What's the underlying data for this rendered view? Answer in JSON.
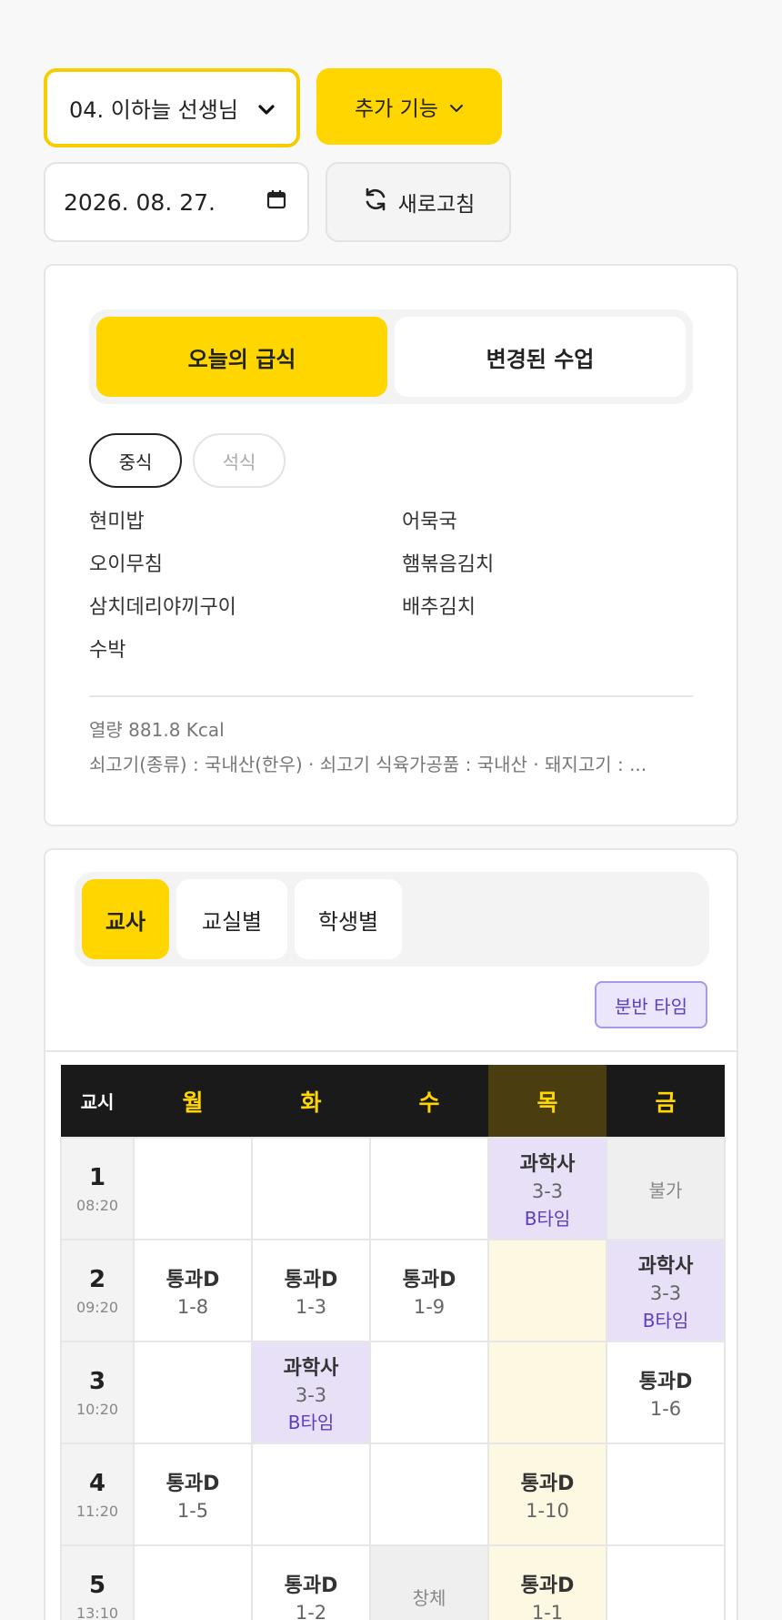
{
  "controls": {
    "teacher_select": "04. 이하늘 선생님",
    "extra_button": "추가 기능",
    "date_value": "2026. 08. 27.",
    "refresh_button": "새로고침"
  },
  "meal": {
    "tabs": [
      "오늘의 급식",
      "변경된 수업"
    ],
    "chips": [
      "중식",
      "석식"
    ],
    "items": [
      "현미밥",
      "어묵국",
      "오이무침",
      "햄볶음김치",
      "삼치데리야끼구이",
      "배추김치",
      "수박"
    ],
    "calories": "열량 881.8 Kcal",
    "origin": "쇠고기(종류) : 국내산(한우) · 쇠고기 식육가공품 : 국내산 · 돼지고기 : ..."
  },
  "timetable": {
    "tabs": [
      "교사",
      "교실별",
      "학생별"
    ],
    "split_badge": "분반 타임",
    "corner": "교시",
    "days": [
      "월",
      "화",
      "수",
      "목",
      "금"
    ],
    "periods": [
      {
        "num": "1",
        "time": "08:20"
      },
      {
        "num": "2",
        "time": "09:20"
      },
      {
        "num": "3",
        "time": "10:20"
      },
      {
        "num": "4",
        "time": "11:20"
      },
      {
        "num": "5",
        "time": "13:10"
      }
    ],
    "cells": {
      "p1_thu": {
        "subject": "과학사",
        "room": "3-3",
        "type": "B타임"
      },
      "p1_fri": {
        "note": "불가"
      },
      "p2_mon": {
        "subject": "통과D",
        "room": "1-8"
      },
      "p2_tue": {
        "subject": "통과D",
        "room": "1-3"
      },
      "p2_wed": {
        "subject": "통과D",
        "room": "1-9"
      },
      "p2_fri": {
        "subject": "과학사",
        "room": "3-3",
        "type": "B타임"
      },
      "p3_tue": {
        "subject": "과학사",
        "room": "3-3",
        "type": "B타임"
      },
      "p3_fri": {
        "subject": "통과D",
        "room": "1-6"
      },
      "p4_mon": {
        "subject": "통과D",
        "room": "1-5"
      },
      "p4_thu": {
        "subject": "통과D",
        "room": "1-10"
      },
      "p5_tue": {
        "subject": "통과D",
        "room": "1-2"
      },
      "p5_wed": {
        "note": "창체"
      },
      "p5_thu": {
        "subject": "통과D",
        "room": "1-1"
      }
    }
  }
}
